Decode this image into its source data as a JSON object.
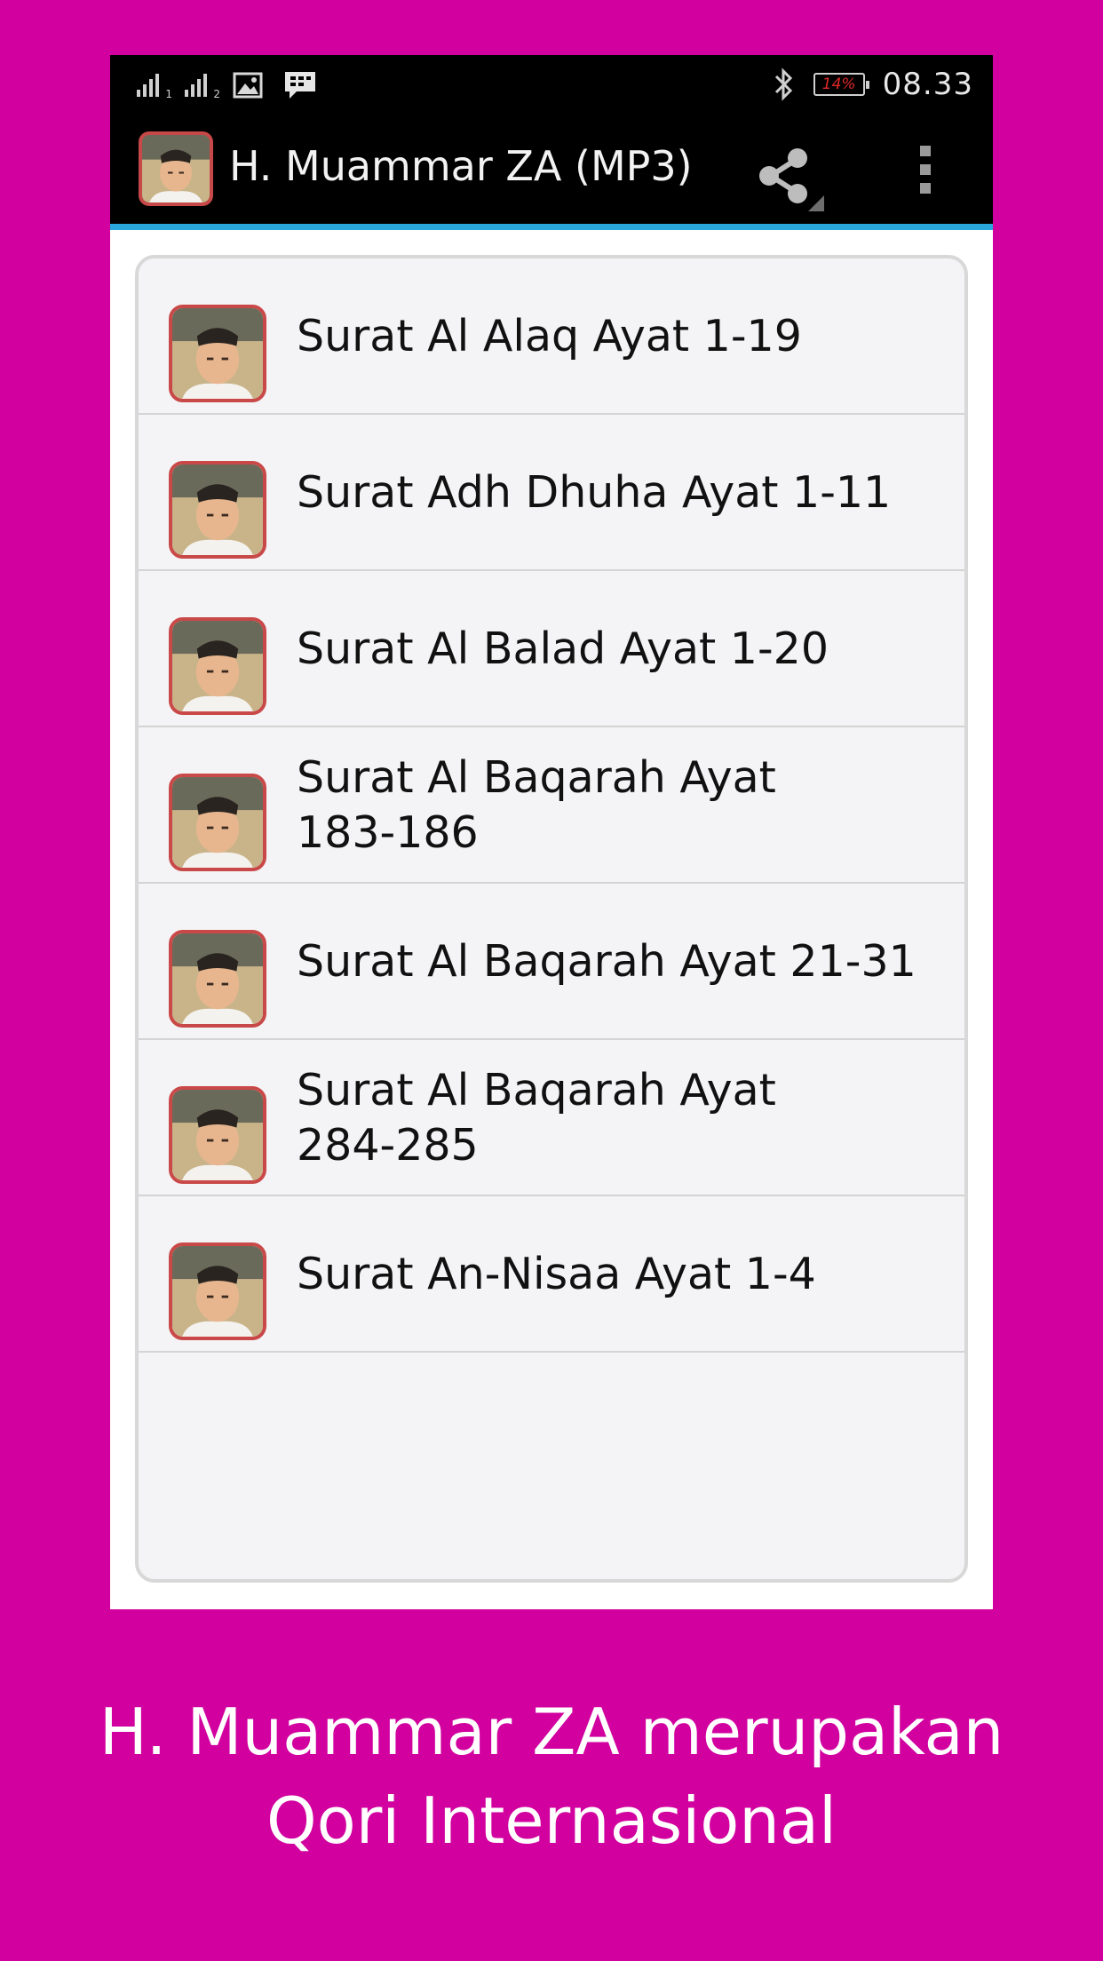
{
  "status_bar": {
    "sim1_label": "1",
    "sim2_label": "2",
    "battery_text": "14%",
    "time": "08.33"
  },
  "action_bar": {
    "title": "H. Muammar ZA (MP3)",
    "share_icon": "share-icon",
    "overflow_icon": "overflow-menu-icon"
  },
  "list": {
    "items": [
      {
        "label": "Surat Al Alaq Ayat 1-19"
      },
      {
        "label": "Surat Adh Dhuha Ayat 1-11"
      },
      {
        "label": "Surat Al Balad Ayat 1-20"
      },
      {
        "label": "Surat Al Baqarah Ayat 183-186"
      },
      {
        "label": "Surat Al Baqarah Ayat 21-31"
      },
      {
        "label": "Surat Al Baqarah Ayat 284-285"
      },
      {
        "label": "Surat An-Nisaa Ayat 1-4"
      }
    ]
  },
  "caption": {
    "line1": "H. Muammar ZA merupakan",
    "line2": "Qori Internasional"
  },
  "colors": {
    "background": "#d1009f",
    "action_bar": "#000000",
    "accent_line": "#2aa7dc",
    "battery_text": "#e02828",
    "thumb_border": "#c94848"
  }
}
